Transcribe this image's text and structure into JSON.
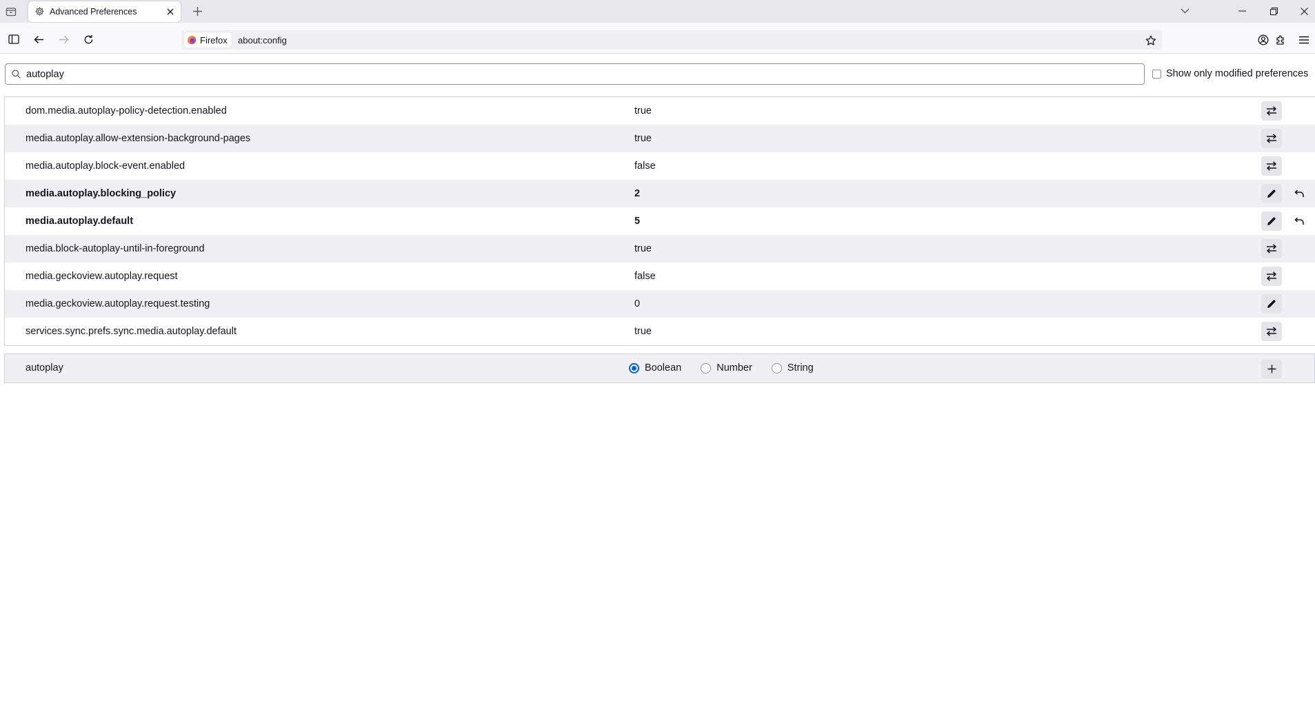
{
  "tab": {
    "title": "Advanced Preferences"
  },
  "urlbar": {
    "identity_label": "Firefox",
    "url": "about:config"
  },
  "search": {
    "value": "autoplay",
    "show_modified_label": "Show only modified preferences"
  },
  "prefs": [
    {
      "name": "dom.media.autoplay-policy-detection.enabled",
      "value": "true",
      "type": "boolean",
      "modified": false
    },
    {
      "name": "media.autoplay.allow-extension-background-pages",
      "value": "true",
      "type": "boolean",
      "modified": false
    },
    {
      "name": "media.autoplay.block-event.enabled",
      "value": "false",
      "type": "boolean",
      "modified": false
    },
    {
      "name": "media.autoplay.blocking_policy",
      "value": "2",
      "type": "number",
      "modified": true
    },
    {
      "name": "media.autoplay.default",
      "value": "5",
      "type": "number",
      "modified": true
    },
    {
      "name": "media.block-autoplay-until-in-foreground",
      "value": "true",
      "type": "boolean",
      "modified": false
    },
    {
      "name": "media.geckoview.autoplay.request",
      "value": "false",
      "type": "boolean",
      "modified": false
    },
    {
      "name": "media.geckoview.autoplay.request.testing",
      "value": "0",
      "type": "number",
      "modified": false
    },
    {
      "name": "services.sync.prefs.sync.media.autoplay.default",
      "value": "true",
      "type": "boolean",
      "modified": false
    }
  ],
  "add_pref": {
    "name": "autoplay",
    "options": [
      "Boolean",
      "Number",
      "String"
    ],
    "selected": "Boolean"
  },
  "colors": {
    "accent": "#0061e0",
    "row_alt": "#f0f0f4",
    "button_bg": "#e4e4e9"
  }
}
